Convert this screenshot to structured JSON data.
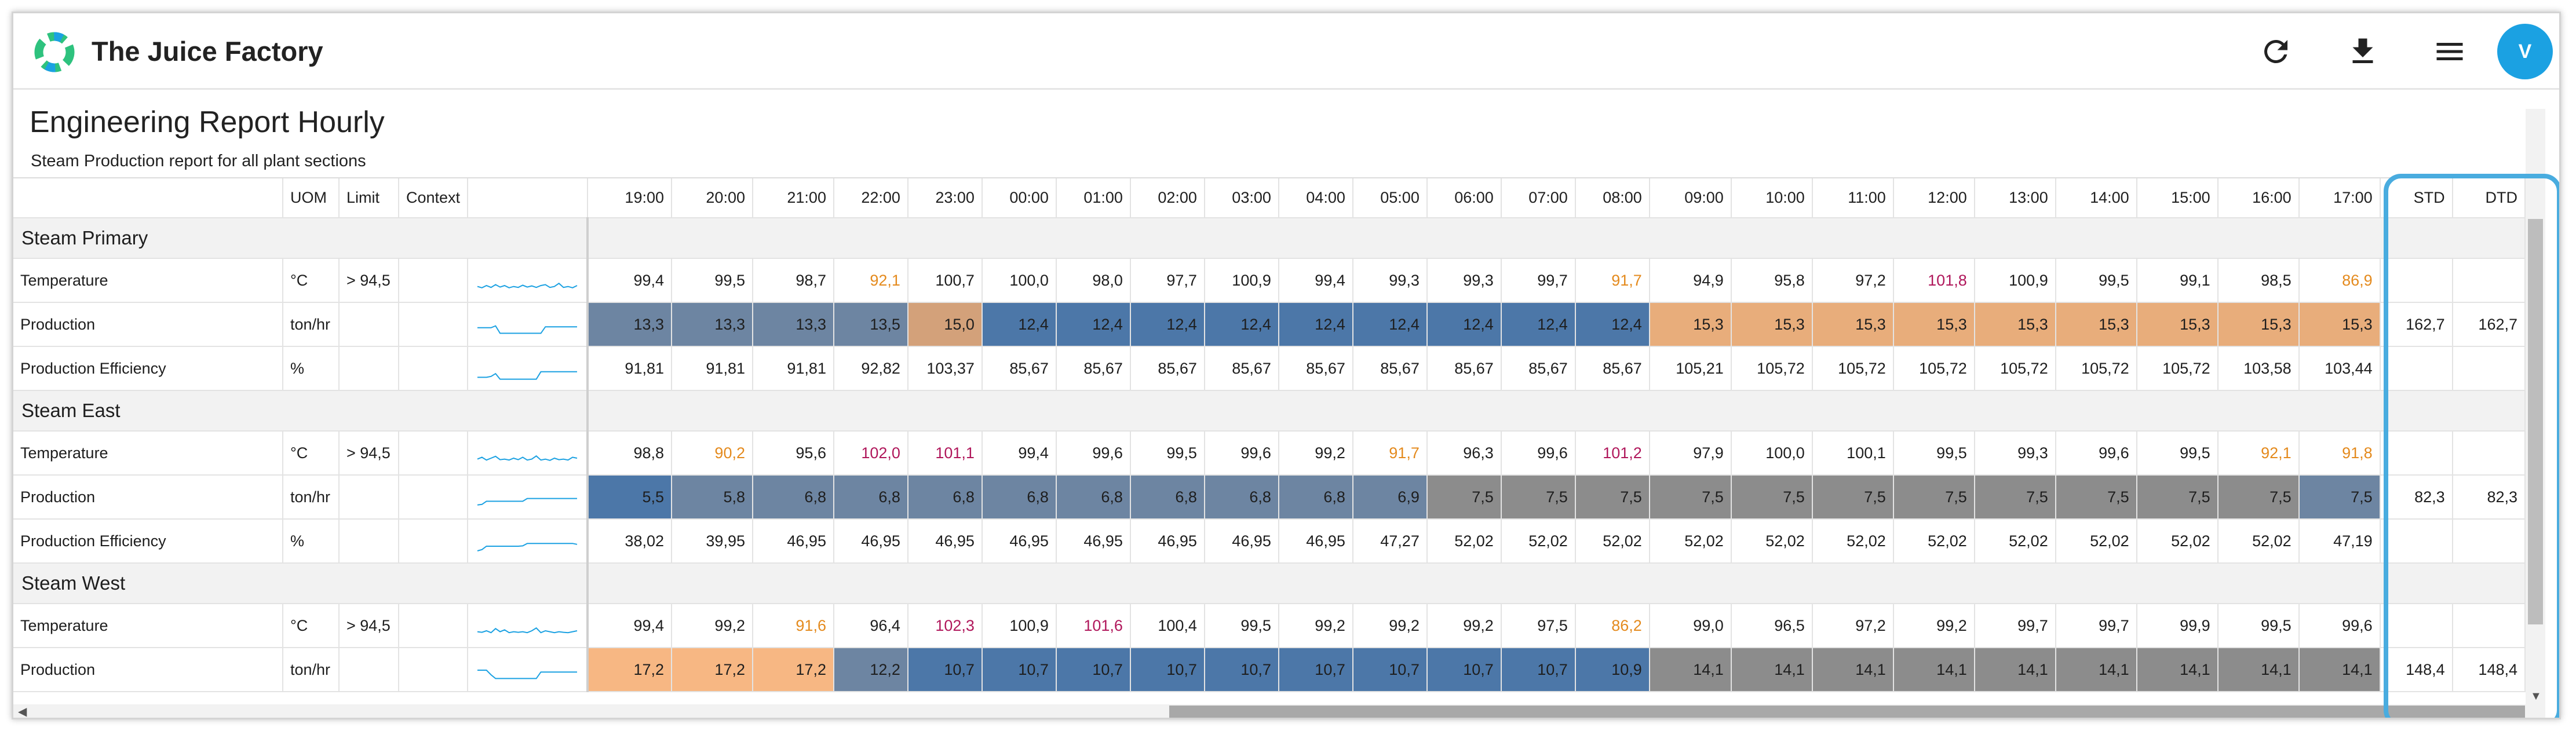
{
  "app": {
    "title": "The Juice Factory",
    "user_initial": "V"
  },
  "icons": {
    "refresh": "refresh-icon",
    "download": "download-icon",
    "menu": "menu-icon",
    "logo": "juice-factory-logo"
  },
  "colors": {
    "accent": "#1ba1e2",
    "highlight": "#49acdf",
    "value_warning": "#e48a1d",
    "value_alert": "#b0175b"
  },
  "report": {
    "title": "Engineering Report Hourly",
    "subtitle": "Steam Production report for all plant sections"
  },
  "columns": {
    "uom": "UOM",
    "limit": "Limit",
    "context": "Context",
    "hours": [
      "19:00",
      "20:00",
      "21:00",
      "22:00",
      "23:00",
      "00:00",
      "01:00",
      "02:00",
      "03:00",
      "04:00",
      "05:00",
      "06:00",
      "07:00",
      "08:00",
      "09:00",
      "10:00",
      "11:00",
      "12:00",
      "13:00",
      "14:00",
      "15:00",
      "16:00",
      "17:00"
    ],
    "std": "STD",
    "dtd": "DTD"
  },
  "sections": [
    {
      "name": "Steam Primary",
      "rows": [
        {
          "label": "Temperature",
          "uom": "°C",
          "limit": "> 94,5",
          "kind": "temp",
          "spark": [
            0.55,
            0.62,
            0.5,
            0.6,
            0.45,
            0.58,
            0.5,
            0.62,
            0.55,
            0.6,
            0.48,
            0.58,
            0.52,
            0.6,
            0.5,
            0.45,
            0.6,
            0.55,
            0.38,
            0.6,
            0.55,
            0.62,
            0.5
          ],
          "values": [
            "99,4",
            "99,5",
            "98,7",
            "92,1",
            "100,7",
            "100,0",
            "98,0",
            "97,7",
            "100,9",
            "99,4",
            "99,3",
            "99,3",
            "99,7",
            "91,7",
            "94,9",
            "95,8",
            "97,2",
            "101,8",
            "100,9",
            "99,5",
            "99,1",
            "98,5",
            "86,9"
          ],
          "tones": [
            "",
            "",
            "",
            "warn",
            "",
            "",
            "",
            "",
            "",
            "",
            "",
            "",
            "",
            "warn",
            "",
            "",
            "",
            "alert",
            "",
            "",
            "",
            "",
            "warn"
          ],
          "std": "",
          "dtd": ""
        },
        {
          "label": "Production",
          "uom": "ton/hr",
          "limit": "",
          "kind": "prod",
          "spark": [
            0.4,
            0.4,
            0.4,
            0.4,
            0.3,
            0.7,
            0.7,
            0.7,
            0.7,
            0.7,
            0.7,
            0.7,
            0.7,
            0.7,
            0.7,
            0.35,
            0.35,
            0.35,
            0.35,
            0.35,
            0.35,
            0.35,
            0.35
          ],
          "values": [
            "13,3",
            "13,3",
            "13,3",
            "13,5",
            "15,0",
            "12,4",
            "12,4",
            "12,4",
            "12,4",
            "12,4",
            "12,4",
            "12,4",
            "12,4",
            "12,4",
            "15,3",
            "15,3",
            "15,3",
            "15,3",
            "15,3",
            "15,3",
            "15,3",
            "15,3",
            "15,3"
          ],
          "cells": [
            "slate",
            "slate",
            "slate",
            "slate",
            "tan",
            "blue",
            "blue",
            "blue",
            "blue",
            "blue",
            "blue",
            "blue",
            "blue",
            "blue",
            "peach",
            "peach",
            "peach",
            "peach",
            "peach",
            "peach",
            "peach",
            "peach",
            "peach"
          ],
          "std": "162,7",
          "dtd": "162,7"
        },
        {
          "label": "Production Efficiency",
          "uom": "%",
          "limit": "",
          "kind": "eff",
          "spark": [
            0.7,
            0.7,
            0.7,
            0.65,
            0.5,
            0.8,
            0.8,
            0.8,
            0.8,
            0.8,
            0.8,
            0.8,
            0.8,
            0.8,
            0.4,
            0.4,
            0.4,
            0.4,
            0.4,
            0.4,
            0.4,
            0.4,
            0.4
          ],
          "values": [
            "91,81",
            "91,81",
            "91,81",
            "92,82",
            "103,37",
            "85,67",
            "85,67",
            "85,67",
            "85,67",
            "85,67",
            "85,67",
            "85,67",
            "85,67",
            "85,67",
            "105,21",
            "105,72",
            "105,72",
            "105,72",
            "105,72",
            "105,72",
            "105,72",
            "103,58",
            "103,44"
          ],
          "std": "",
          "dtd": ""
        }
      ]
    },
    {
      "name": "Steam East",
      "rows": [
        {
          "label": "Temperature",
          "uom": "°C",
          "limit": "> 94,5",
          "kind": "temp",
          "spark": [
            0.55,
            0.45,
            0.6,
            0.5,
            0.4,
            0.58,
            0.55,
            0.6,
            0.5,
            0.58,
            0.45,
            0.6,
            0.55,
            0.38,
            0.6,
            0.55,
            0.62,
            0.5,
            0.58,
            0.55,
            0.6,
            0.45,
            0.5
          ],
          "values": [
            "98,8",
            "90,2",
            "95,6",
            "102,0",
            "101,1",
            "99,4",
            "99,6",
            "99,5",
            "99,6",
            "99,2",
            "91,7",
            "96,3",
            "99,6",
            "101,2",
            "97,9",
            "100,0",
            "100,1",
            "99,5",
            "99,3",
            "99,6",
            "99,5",
            "92,1",
            "91,8"
          ],
          "tones": [
            "",
            "warn",
            "",
            "alert",
            "alert",
            "",
            "",
            "",
            "",
            "",
            "warn",
            "",
            "",
            "alert",
            "",
            "",
            "",
            "",
            "",
            "",
            "",
            "warn",
            "warn"
          ],
          "std": "",
          "dtd": ""
        },
        {
          "label": "Production",
          "uom": "ton/hr",
          "limit": "",
          "kind": "prod",
          "spark": [
            0.65,
            0.62,
            0.45,
            0.45,
            0.45,
            0.45,
            0.45,
            0.45,
            0.45,
            0.45,
            0.45,
            0.3,
            0.3,
            0.3,
            0.3,
            0.3,
            0.3,
            0.3,
            0.3,
            0.3,
            0.3,
            0.3,
            0.3
          ],
          "values": [
            "5,5",
            "5,8",
            "6,8",
            "6,8",
            "6,8",
            "6,8",
            "6,8",
            "6,8",
            "6,8",
            "6,8",
            "6,9",
            "7,5",
            "7,5",
            "7,5",
            "7,5",
            "7,5",
            "7,5",
            "7,5",
            "7,5",
            "7,5",
            "7,5",
            "7,5",
            "7,5"
          ],
          "cells": [
            "blue",
            "slate",
            "slate",
            "slate",
            "slate",
            "slate",
            "slate",
            "slate",
            "slate",
            "slate",
            "slate",
            "gray",
            "gray",
            "gray",
            "gray",
            "gray",
            "gray",
            "gray",
            "gray",
            "gray",
            "gray",
            "gray",
            "slate"
          ],
          "std": "82,3",
          "dtd": "82,3"
        },
        {
          "label": "Production Efficiency",
          "uom": "%",
          "limit": "",
          "kind": "eff",
          "spark": [
            0.75,
            0.68,
            0.5,
            0.5,
            0.5,
            0.5,
            0.5,
            0.5,
            0.5,
            0.5,
            0.48,
            0.35,
            0.35,
            0.35,
            0.35,
            0.35,
            0.35,
            0.35,
            0.35,
            0.35,
            0.35,
            0.35,
            0.4
          ],
          "values": [
            "38,02",
            "39,95",
            "46,95",
            "46,95",
            "46,95",
            "46,95",
            "46,95",
            "46,95",
            "46,95",
            "46,95",
            "47,27",
            "52,02",
            "52,02",
            "52,02",
            "52,02",
            "52,02",
            "52,02",
            "52,02",
            "52,02",
            "52,02",
            "52,02",
            "52,02",
            "47,19"
          ],
          "std": "",
          "dtd": ""
        }
      ]
    },
    {
      "name": "Steam West",
      "rows": [
        {
          "label": "Temperature",
          "uom": "°C",
          "limit": "> 94,5",
          "kind": "temp",
          "spark": [
            0.55,
            0.58,
            0.5,
            0.6,
            0.38,
            0.55,
            0.45,
            0.6,
            0.55,
            0.58,
            0.55,
            0.6,
            0.5,
            0.35,
            0.6,
            0.5,
            0.55,
            0.6,
            0.55,
            0.58,
            0.6,
            0.55,
            0.5
          ],
          "values": [
            "99,4",
            "99,2",
            "91,6",
            "96,4",
            "102,3",
            "100,9",
            "101,6",
            "100,4",
            "99,5",
            "99,2",
            "99,2",
            "99,2",
            "97,5",
            "86,2",
            "99,0",
            "96,5",
            "97,2",
            "99,2",
            "99,7",
            "99,7",
            "99,9",
            "99,5",
            "99,6"
          ],
          "tones": [
            "",
            "",
            "warn",
            "",
            "alert",
            "",
            "alert",
            "",
            "",
            "",
            "",
            "",
            "",
            "warn",
            "",
            "",
            "",
            "",
            "",
            "",
            "",
            "",
            ""
          ],
          "std": "",
          "dtd": ""
        },
        {
          "label": "Production",
          "uom": "ton/hr",
          "limit": "",
          "kind": "prod",
          "spark": [
            0.25,
            0.25,
            0.25,
            0.5,
            0.7,
            0.7,
            0.7,
            0.7,
            0.7,
            0.7,
            0.7,
            0.7,
            0.7,
            0.7,
            0.35,
            0.35,
            0.35,
            0.35,
            0.35,
            0.35,
            0.35,
            0.35,
            0.35
          ],
          "values": [
            "17,2",
            "17,2",
            "17,2",
            "12,2",
            "10,7",
            "10,7",
            "10,7",
            "10,7",
            "10,7",
            "10,7",
            "10,7",
            "10,7",
            "10,7",
            "10,9",
            "14,1",
            "14,1",
            "14,1",
            "14,1",
            "14,1",
            "14,1",
            "14,1",
            "14,1",
            "14,1"
          ],
          "cells": [
            "lpeach",
            "lpeach",
            "lpeach",
            "slate",
            "blue",
            "blue",
            "blue",
            "blue",
            "blue",
            "blue",
            "blue",
            "blue",
            "blue",
            "blue",
            "gray",
            "gray",
            "gray",
            "gray",
            "gray",
            "gray",
            "gray",
            "gray",
            "gray"
          ],
          "std": "148,4",
          "dtd": "148,4"
        }
      ]
    }
  ]
}
